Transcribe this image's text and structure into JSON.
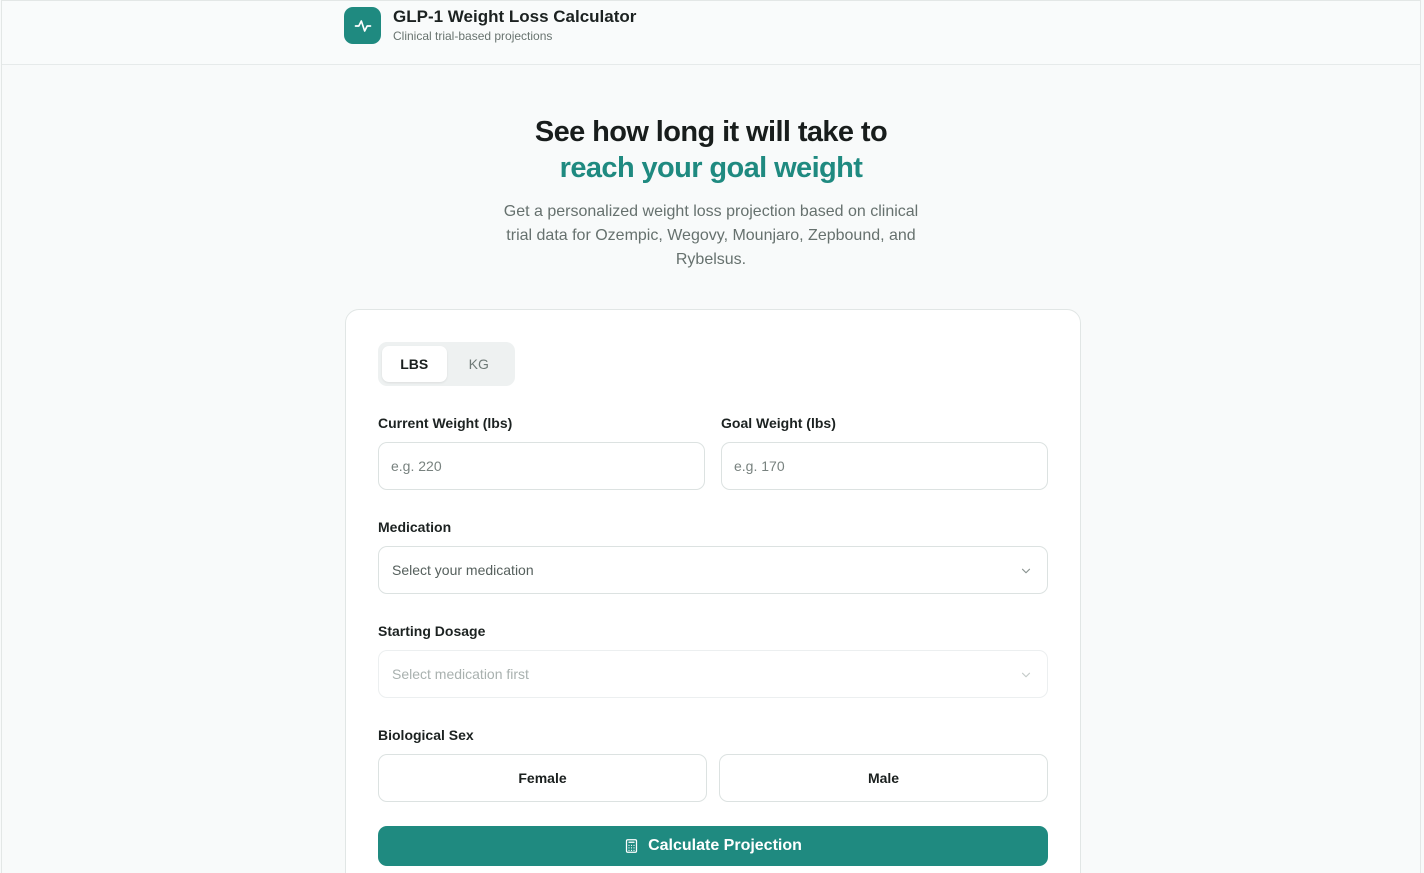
{
  "header": {
    "title": "GLP-1 Weight Loss Calculator",
    "subtitle": "Clinical trial-based projections",
    "logo_icon": "activity-pulse-icon"
  },
  "hero": {
    "line1": "See how long it will take to",
    "line2": "reach your goal weight",
    "description": "Get a personalized weight loss projection based on clinical trial data for Ozempic, Wegovy, Mounjaro, Zepbound, and Rybelsus."
  },
  "form": {
    "units": [
      {
        "label": "LBS",
        "active": true
      },
      {
        "label": "KG",
        "active": false
      }
    ],
    "current_weight": {
      "label": "Current Weight (lbs)",
      "placeholder": "e.g. 220",
      "value": ""
    },
    "goal_weight": {
      "label": "Goal Weight (lbs)",
      "placeholder": "e.g. 170",
      "value": ""
    },
    "medication": {
      "label": "Medication",
      "selected": "Select your medication"
    },
    "dosage": {
      "label": "Starting Dosage",
      "selected": "Select medication first",
      "disabled": true
    },
    "sex": {
      "label": "Biological Sex",
      "options": [
        "Female",
        "Male"
      ]
    },
    "submit_label": "Calculate Projection",
    "submit_icon": "calculator-icon"
  },
  "colors": {
    "accent": "#1f8a80",
    "background": "#f8fafa",
    "card": "#ffffff"
  }
}
